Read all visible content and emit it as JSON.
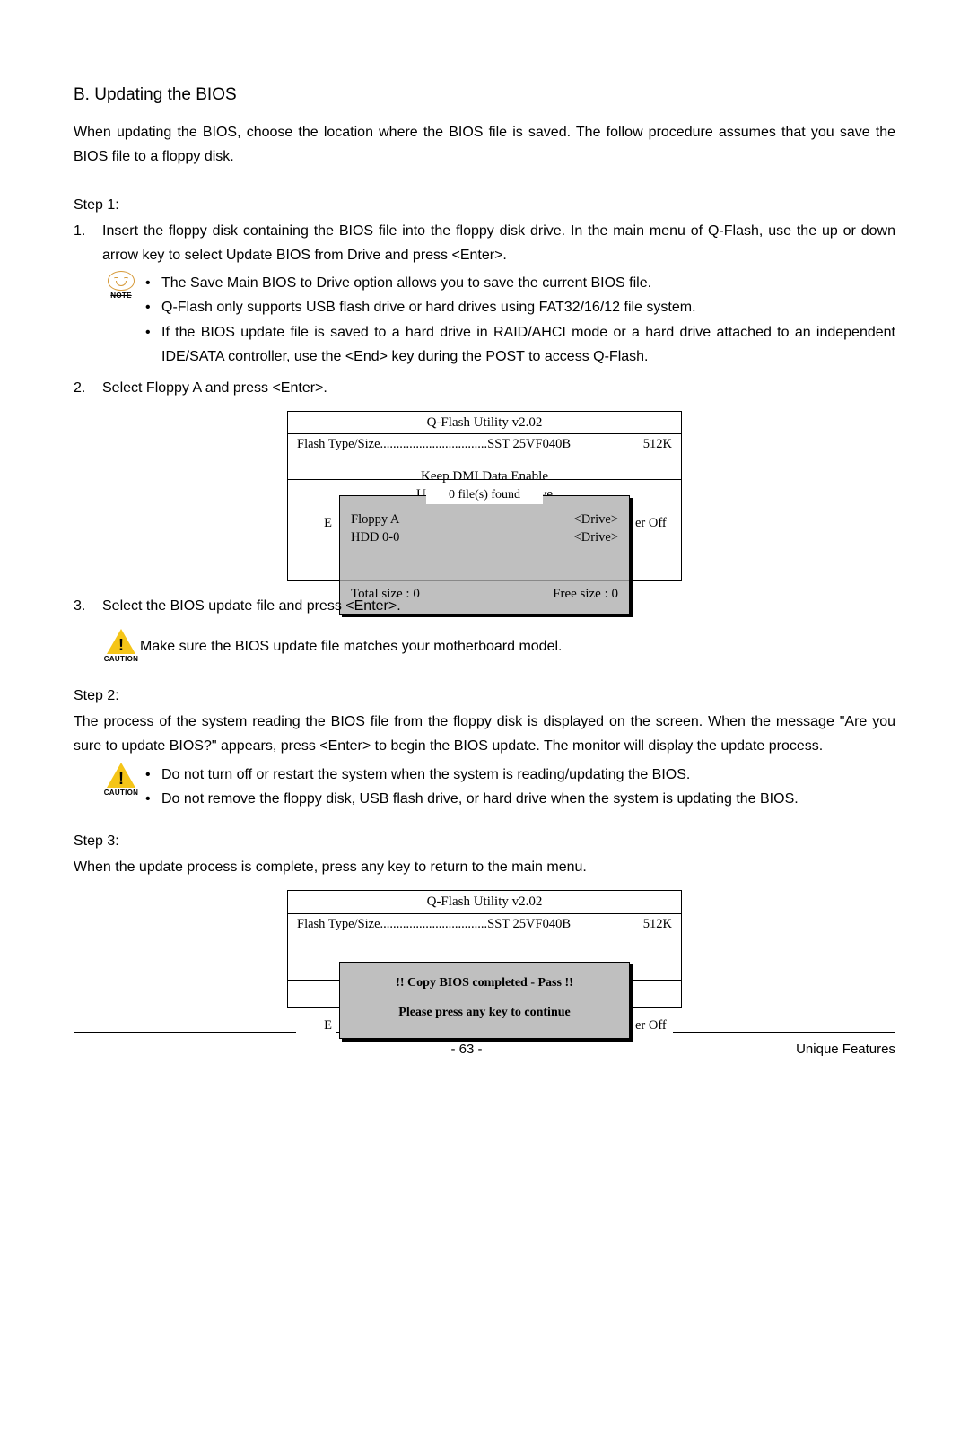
{
  "heading": "B. Updating the BIOS",
  "intro": "When updating the BIOS, choose the location where the BIOS file is saved. The follow procedure assumes that you save the BIOS file to a floppy disk.",
  "step1_label": "Step 1:",
  "step1_item1_num": "1.",
  "step1_item1_a": "Insert the floppy disk containing the BIOS file into the floppy disk drive. In the main menu of Q-Flash, use the up or down arrow key to select ",
  "step1_item1_b": "Update BIOS from Drive",
  "step1_item1_c": " and press <Enter>.",
  "note_label": "NOTE",
  "note_bullets": [
    {
      "pre": "The ",
      "bold": "Save Main BIOS to Drive",
      "post": " option allows you to save the current BIOS file."
    },
    {
      "pre": "Q-Flash only supports USB flash drive or hard drives using FAT32/16/12 file system.",
      "bold": "",
      "post": ""
    },
    {
      "pre": "If the BIOS update file is saved to a hard drive in RAID/AHCI mode or a hard drive attached to an independent IDE/SATA controller, use the <End> key during the POST to access Q-Flash.",
      "bold": "",
      "post": ""
    }
  ],
  "step1_item2_num": "2.",
  "step1_item2_a": "Select ",
  "step1_item2_b": "Floppy A",
  "step1_item2_c": " and press <Enter>.",
  "qflash1": {
    "title": "Q-Flash Utility v2.02",
    "flash_label": "Flash Type/Size.................................SST 25VF040B",
    "flash_size": "512K",
    "dmi": "Keep DMI Data   Enable",
    "update": "Update BIOS from Drive",
    "popup_caption": "0 file(s) found",
    "drive_a": "Floppy A",
    "drive_a_tag": "<Drive>",
    "hdd": "HDD 0-0",
    "hdd_tag": "<Drive>",
    "total": "Total size : 0",
    "free": "Free size : 0",
    "behind_left": "E",
    "behind_right": "er Off"
  },
  "step1_item3_num": "3.",
  "step1_item3": "Select the BIOS update file and press <Enter>.",
  "caution_label": "CAUTION",
  "caution1_text": "Make sure the BIOS update file matches your motherboard model.",
  "step2_label": "Step 2:",
  "step2_para": "The process of the system reading the BIOS file from the floppy disk is displayed on the screen. When the message \"Are you sure to update BIOS?\" appears, press <Enter> to begin the BIOS update. The monitor will display the update process.",
  "caution2_bullets": [
    "Do not turn off or restart the system when the system is reading/updating the BIOS.",
    "Do not remove the floppy disk, USB flash drive, or hard drive when the system is updating the BIOS."
  ],
  "step3_label": "Step 3:",
  "step3_para": "When the update process is complete, press any key to return to the main menu.",
  "qflash2": {
    "title": "Q-Flash Utility v2.02",
    "flash_label": "Flash Type/Size.................................SST 25VF040B",
    "flash_size": "512K",
    "msg1": "!! Copy BIOS completed - Pass !!",
    "msg2": "Please press any key to continue",
    "behind_left": "E",
    "behind_right": "er Off"
  },
  "footer": {
    "page": "- 63 -",
    "section": "Unique Features"
  }
}
